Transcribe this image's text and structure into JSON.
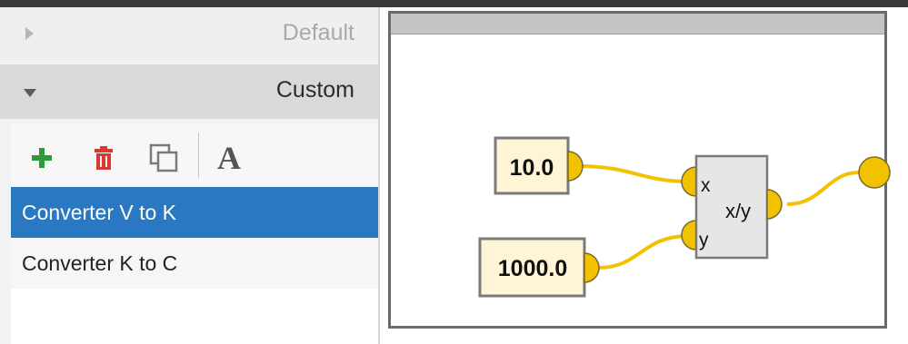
{
  "groups": {
    "default_label": "Default",
    "custom_label": "Custom"
  },
  "toolbar": {
    "add_icon": "plus-icon",
    "delete_icon": "trash-icon",
    "duplicate_icon": "copy-icon",
    "font_icon": "font-icon",
    "font_glyph": "A"
  },
  "list": {
    "items": [
      {
        "label": "Converter V to K",
        "selected": true
      },
      {
        "label": "Converter K to C",
        "selected": false
      }
    ]
  },
  "graph": {
    "input_x_value": "10.0",
    "input_y_value": "1000.0",
    "op_label": "x/y",
    "port_x_label": "x",
    "port_y_label": "y"
  },
  "colors": {
    "selection": "#2b78c2",
    "port": "#f2c200",
    "wire": "#f2c200",
    "input_node_fill": "#fff5d6",
    "op_node_fill": "#e6e6e6"
  }
}
